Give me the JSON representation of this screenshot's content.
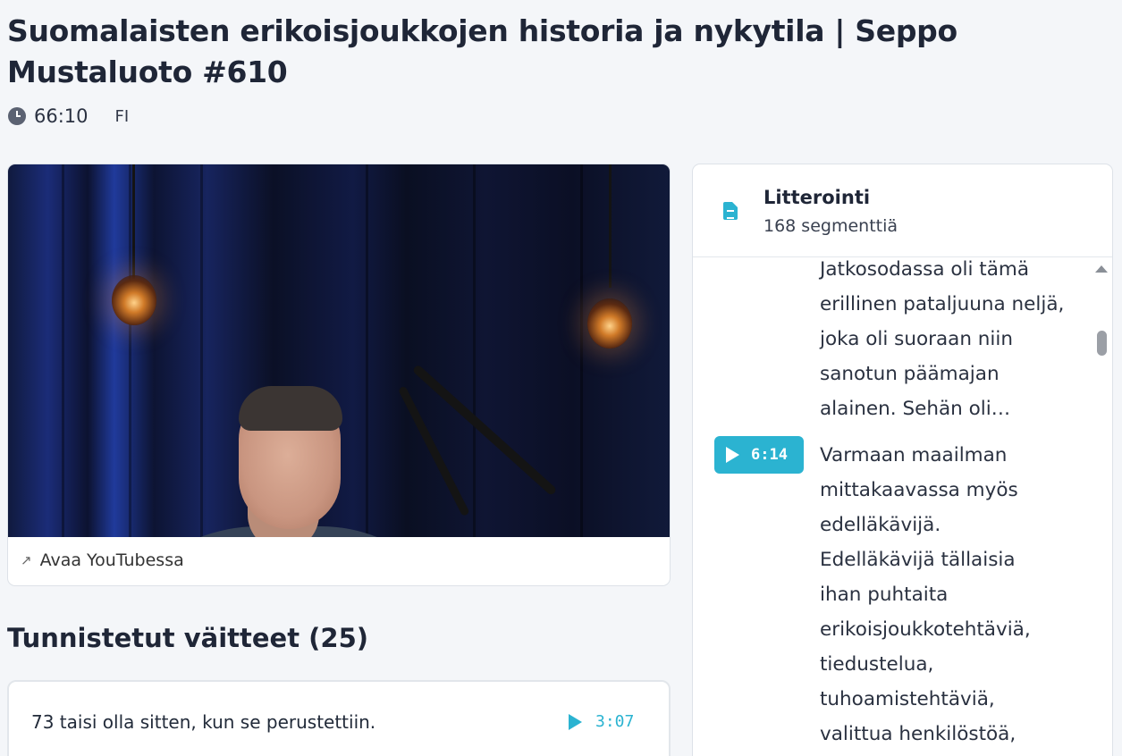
{
  "page": {
    "title": "Suomalaisten erikoisjoukkojen historia ja nykytila | Seppo Mustaluoto #610",
    "duration": "66:10",
    "language": "FI"
  },
  "video": {
    "open_youtube_label": "Avaa YouTubessa",
    "icons": {
      "external_link": "arrow-up-left-icon"
    }
  },
  "claims": {
    "heading": "Tunnistetut väitteet (25)",
    "items": [
      {
        "text": "73 taisi olla sitten, kun se perustettiin.",
        "time": "3:07"
      }
    ]
  },
  "transcript": {
    "title": "Litterointi",
    "count": "168 segmenttiä",
    "segments": [
      {
        "time": "",
        "lines": [
          "Jatkosodassa oli tämä",
          "erillinen pataljuuna neljä,",
          "joka oli suoraan niin",
          "sanotun päämajan",
          "alainen. Sehän oli…"
        ]
      },
      {
        "time": "6:14",
        "lines": [
          "Varmaan maailman",
          "mittakaavassa myös",
          "edelläkävijä.",
          "Edelläkävijä tällaisia",
          "ihan puhtaita",
          "erikoisjoukkotehtäviä,",
          "tiedustelua,",
          "tuhoamistehtäviä,",
          "valittua henkilöstöä,"
        ]
      }
    ]
  },
  "colors": {
    "accent": "#2bb3d1",
    "background": "#f4f6f9",
    "text": "#1f2637"
  }
}
